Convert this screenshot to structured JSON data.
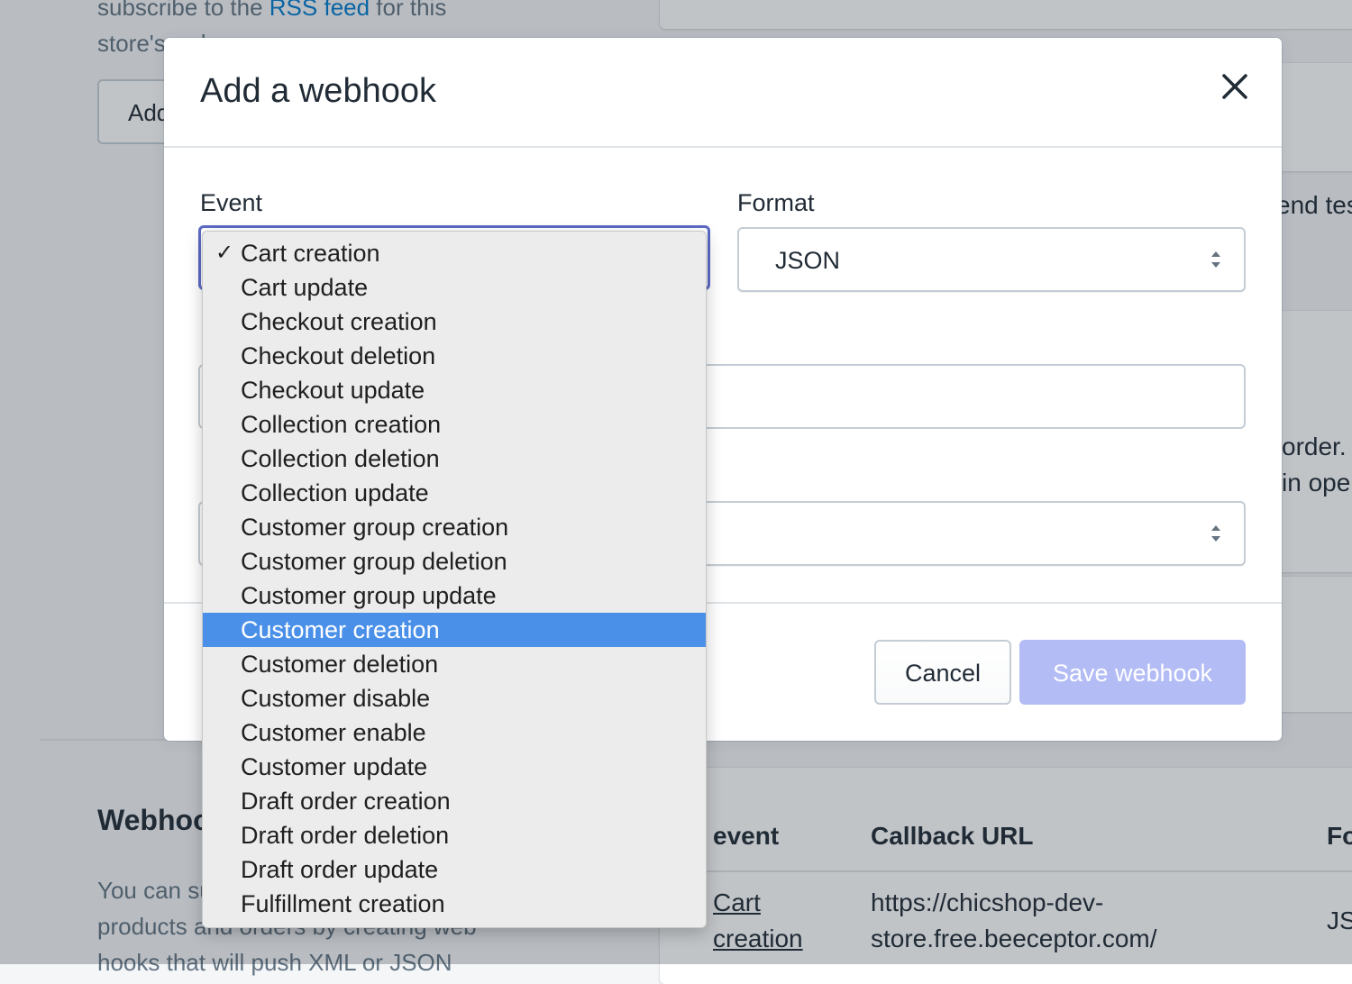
{
  "background": {
    "rss_text_prefix": "subscribe to the ",
    "rss_link": "RSS feed",
    "rss_text_suffix": " for this store's orders",
    "add_button_label": "Add",
    "send_test_link": "end tes",
    "side_text_1": "order.",
    "side_text_2": "in ope",
    "webhooks_title": "Webhooks",
    "webhooks_description": "You can subscribe to events for your products and orders by creating web hooks that will push XML or JSON",
    "table": {
      "headers": [
        "event",
        "Callback URL",
        "Fo"
      ],
      "rows": [
        {
          "event": "Cart creation",
          "url": "https://chicshop-dev-store.free.beeceptor.com/",
          "format": "JS"
        }
      ]
    }
  },
  "modal": {
    "title": "Add a webhook",
    "event_label": "Event",
    "format_label": "Format",
    "format_value": "JSON",
    "cancel_label": "Cancel",
    "save_label": "Save webhook"
  },
  "dropdown": {
    "selected": "Cart creation",
    "highlighted": "Customer creation",
    "options": [
      "Cart creation",
      "Cart update",
      "Checkout creation",
      "Checkout deletion",
      "Checkout update",
      "Collection creation",
      "Collection deletion",
      "Collection update",
      "Customer group creation",
      "Customer group deletion",
      "Customer group update",
      "Customer creation",
      "Customer deletion",
      "Customer disable",
      "Customer enable",
      "Customer update",
      "Draft order creation",
      "Draft order deletion",
      "Draft order update",
      "Fulfillment creation"
    ]
  },
  "colors": {
    "focus_border": "#5c6ac4",
    "highlight": "#4a90e9",
    "primary_disabled": "#b3bcf5",
    "link": "#007ace"
  }
}
